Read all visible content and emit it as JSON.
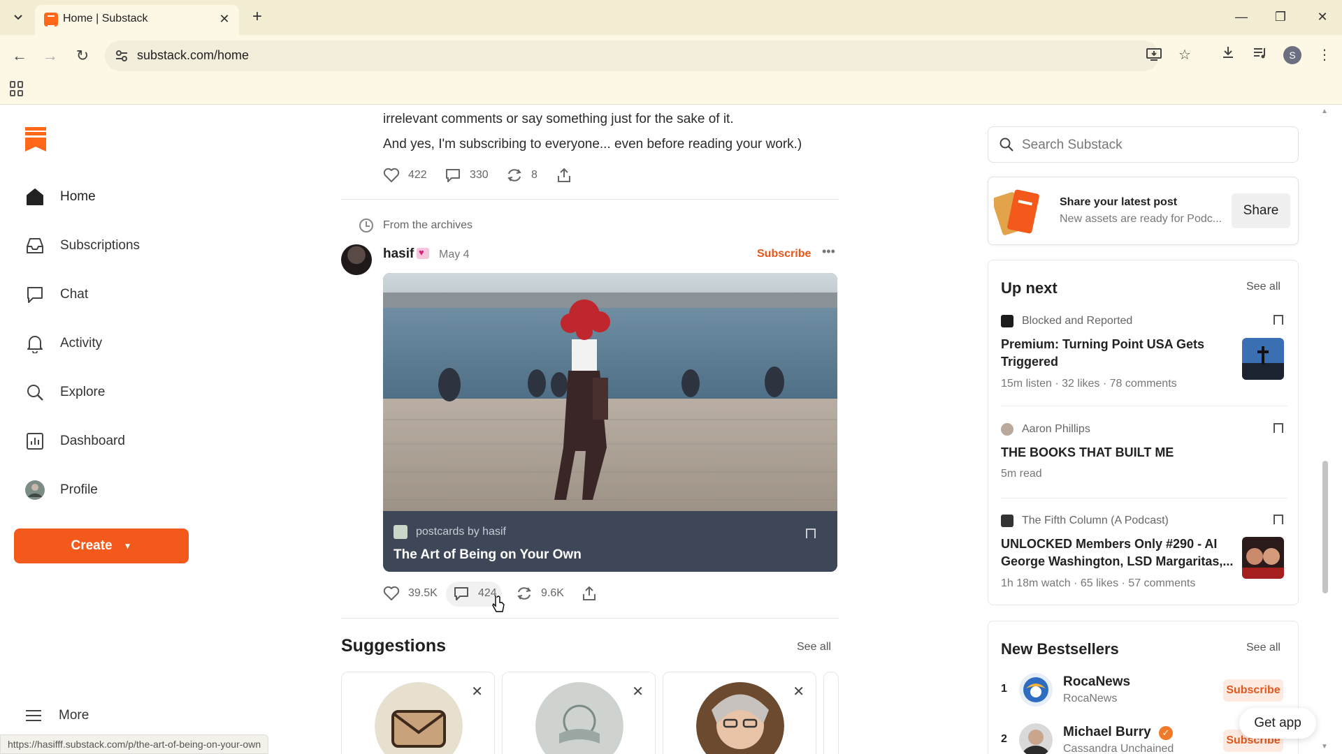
{
  "browser": {
    "tab_title": "Home | Substack",
    "url": "substack.com/home",
    "profile_initial": "S",
    "status_url": "https://hasifff.substack.com/p/the-art-of-being-on-your-own"
  },
  "nav": {
    "items": [
      {
        "label": "Home",
        "icon": "home-icon"
      },
      {
        "label": "Subscriptions",
        "icon": "inbox-icon"
      },
      {
        "label": "Chat",
        "icon": "chat-icon"
      },
      {
        "label": "Activity",
        "icon": "bell-icon"
      },
      {
        "label": "Explore",
        "icon": "search-icon"
      },
      {
        "label": "Dashboard",
        "icon": "dashboard-icon"
      },
      {
        "label": "Profile",
        "icon": "avatar"
      }
    ],
    "create_label": "Create",
    "more_label": "More"
  },
  "feed": {
    "prev_post": {
      "text_line1": "irrelevant comments or say something just for the sake of it.",
      "text_line2": "And yes, I'm subscribing to everyone... even before reading your work.)",
      "likes": "422",
      "comments": "330",
      "restacks": "8"
    },
    "archive_label": "From the archives",
    "post": {
      "author": "hasif",
      "date": "May 4",
      "subscribe_label": "Subscribe",
      "publication": "postcards by hasif",
      "title": "The Art of Being on Your Own",
      "likes": "39.5K",
      "comments": "424",
      "restacks": "9.6K"
    },
    "suggestions": {
      "title": "Suggestions",
      "see_all": "See all"
    }
  },
  "sidebar": {
    "search_placeholder": "Search Substack",
    "share": {
      "title": "Share your latest post",
      "subtitle": "New assets are ready for Podc...",
      "button": "Share"
    },
    "up_next": {
      "title": "Up next",
      "see_all": "See all",
      "items": [
        {
          "publication": "Blocked and Reported",
          "title_line1": "Premium: Turning Point USA Gets",
          "title_line2": "Triggered",
          "meta": "15m listen · 32 likes · 78 comments"
        },
        {
          "publication": "Aaron Phillips",
          "title_line1": "THE BOOKS THAT BUILT ME",
          "meta": "5m read"
        },
        {
          "publication": "The Fifth Column (A Podcast)",
          "title_line1": "UNLOCKED Members Only #290 - AI",
          "title_line2": "George Washington, LSD Margaritas,...",
          "meta": "1h 18m watch · 65 likes · 57 comments"
        }
      ]
    },
    "bestsellers": {
      "title": "New Bestsellers",
      "see_all": "See all",
      "items": [
        {
          "rank": "1",
          "name": "RocaNews",
          "sub": "RocaNews",
          "button": "Subscribe"
        },
        {
          "rank": "2",
          "name": "Michael Burry",
          "sub": "Cassandra Unchained",
          "button": "Subscribe"
        }
      ]
    },
    "get_app": "Get app"
  }
}
